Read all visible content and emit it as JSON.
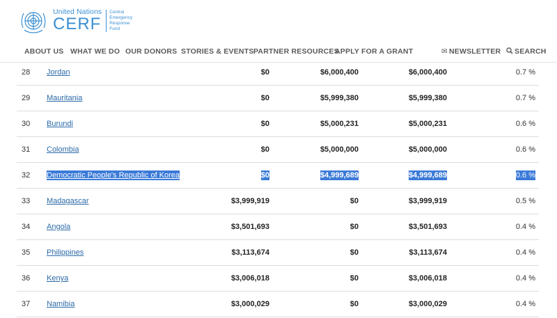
{
  "brand": {
    "org": "United Nations",
    "name": "CERF",
    "sub": [
      "Central",
      "Emergency",
      "Response",
      "Fund"
    ]
  },
  "nav": {
    "items": [
      "ABOUT US",
      "WHAT WE DO",
      "OUR DONORS",
      "STORIES & EVENTS",
      "PARTNER RESOURCES",
      "APPLY FOR A GRANT"
    ],
    "newsletter": "NEWSLETTER",
    "search": "SEARCH",
    "newsletter_icon": "envelope-icon",
    "search_icon": "magnifier-icon"
  },
  "colors": {
    "brand": "#3a8fd3",
    "link": "#2b6aa8",
    "selection": "#3a7ad8"
  },
  "table": {
    "rows": [
      {
        "rank": "28",
        "country": "Jordan",
        "a": "$0",
        "b": "$6,000,400",
        "total": "$6,000,400",
        "pct": "0.7 %"
      },
      {
        "rank": "29",
        "country": "Mauritania",
        "a": "$0",
        "b": "$5,999,380",
        "total": "$5,999,380",
        "pct": "0.7 %"
      },
      {
        "rank": "30",
        "country": "Burundi",
        "a": "$0",
        "b": "$5,000,231",
        "total": "$5,000,231",
        "pct": "0.6 %"
      },
      {
        "rank": "31",
        "country": "Colombia",
        "a": "$0",
        "b": "$5,000,000",
        "total": "$5,000,000",
        "pct": "0.6 %"
      },
      {
        "rank": "32",
        "country": "Democratic People's Republic of Korea",
        "a": "$0",
        "b": "$4,999,689",
        "total": "$4,999,689",
        "pct": "0.6 %",
        "selected": true
      },
      {
        "rank": "33",
        "country": "Madagascar",
        "a": "$3,999,919",
        "b": "$0",
        "total": "$3,999,919",
        "pct": "0.5 %"
      },
      {
        "rank": "34",
        "country": "Angola",
        "a": "$3,501,693",
        "b": "$0",
        "total": "$3,501,693",
        "pct": "0.4 %"
      },
      {
        "rank": "35",
        "country": "Philippines",
        "a": "$3,113,674",
        "b": "$0",
        "total": "$3,113,674",
        "pct": "0.4 %"
      },
      {
        "rank": "36",
        "country": "Kenya",
        "a": "$3,006,018",
        "b": "$0",
        "total": "$3,006,018",
        "pct": "0.4 %"
      },
      {
        "rank": "37",
        "country": "Namibia",
        "a": "$3,000,029",
        "b": "$0",
        "total": "$3,000,029",
        "pct": "0.4 %"
      }
    ]
  }
}
